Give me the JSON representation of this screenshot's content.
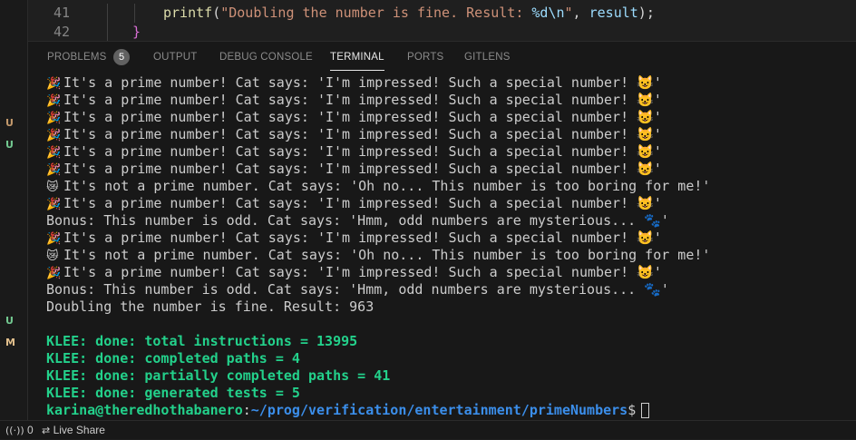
{
  "editor": {
    "lines": [
      {
        "number": "41",
        "fn": "printf",
        "open": "(",
        "str_a": "\"Doubling the number is fine. Result: ",
        "fmt": "%d\\n",
        "str_b": "\"",
        "sep": ", ",
        "arg": "result",
        "close": ");"
      },
      {
        "number": "42",
        "brace": "}"
      }
    ]
  },
  "panel": {
    "tabs": [
      {
        "label": "PROBLEMS",
        "badge": "5",
        "active": false
      },
      {
        "label": "OUTPUT",
        "active": false
      },
      {
        "label": "DEBUG CONSOLE",
        "active": false
      },
      {
        "label": "TERMINAL",
        "active": true
      },
      {
        "label": "PORTS",
        "active": false
      },
      {
        "label": "GITLENS",
        "active": false
      }
    ]
  },
  "terminal": {
    "lines": [
      {
        "emoji": "🎉",
        "text": "It's a prime number! Cat says: 'I'm impressed! Such a special number! 😺'"
      },
      {
        "emoji": "🎉",
        "text": "It's a prime number! Cat says: 'I'm impressed! Such a special number! 😺'"
      },
      {
        "emoji": "🎉",
        "text": "It's a prime number! Cat says: 'I'm impressed! Such a special number! 😺'"
      },
      {
        "emoji": "🎉",
        "text": "It's a prime number! Cat says: 'I'm impressed! Such a special number! 😺'"
      },
      {
        "emoji": "🎉",
        "text": "It's a prime number! Cat says: 'I'm impressed! Such a special number! 😺'"
      },
      {
        "emoji": "🎉",
        "text": "It's a prime number! Cat says: 'I'm impressed! Such a special number! 😺'"
      },
      {
        "emoji": "😿",
        "text": "It's not a prime number. Cat says: 'Oh no... This number is too boring for me!'"
      },
      {
        "emoji": "🎉",
        "text": "It's a prime number! Cat says: 'I'm impressed! Such a special number! 😺'"
      },
      {
        "emoji": "",
        "text": "Bonus: This number is odd. Cat says: 'Hmm, odd numbers are mysterious... 🐾'"
      },
      {
        "emoji": "🎉",
        "text": "It's a prime number! Cat says: 'I'm impressed! Such a special number! 😺'"
      },
      {
        "emoji": "😿",
        "text": "It's not a prime number. Cat says: 'Oh no... This number is too boring for me!'"
      },
      {
        "emoji": "🎉",
        "text": "It's a prime number! Cat says: 'I'm impressed! Such a special number! 😺'"
      },
      {
        "emoji": "",
        "text": "Bonus: This number is odd. Cat says: 'Hmm, odd numbers are mysterious... 🐾'"
      },
      {
        "emoji": "",
        "text": "Doubling the number is fine. Result: 963"
      },
      {
        "emoji": "",
        "text": ""
      }
    ],
    "klee": [
      "KLEE: done: total instructions = 13995",
      "KLEE: done: completed paths = 4",
      "KLEE: done: partially completed paths = 41",
      "KLEE: done: generated tests = 5"
    ],
    "prompt": {
      "user_host": "karina@theredhothabanero",
      "sep": ":",
      "path": "~/prog/verification/entertainment/primeNumbers",
      "symbol": "$"
    }
  },
  "explorer_badges": [
    {
      "letter": "U",
      "color": "#c49a6c"
    },
    {
      "letter": "U",
      "color": "#73c991"
    },
    {
      "letter": "U",
      "color": "#73c991"
    },
    {
      "letter": "M",
      "color": "#e2c08d"
    }
  ],
  "statusbar": {
    "remote_icon": "broadcast-icon",
    "remote_count": "0",
    "liveshare_icon": "live-share-icon",
    "liveshare_label": "Live Share"
  }
}
